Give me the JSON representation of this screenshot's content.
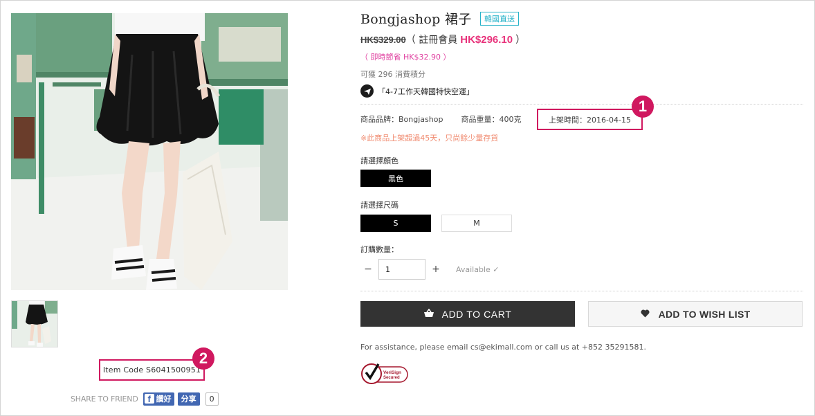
{
  "product": {
    "title": "Bongjashop 裙子",
    "tag": "韓國直送",
    "old_price": "HK$329.00",
    "price_prefix": "（ 註冊會員",
    "member_price": "HK$296.10",
    "price_suffix": "）",
    "save_text": "（ 即時節省 HK$32.90 ）",
    "points_text": "可獲 296 消費積分",
    "shipping_text": "「4-7工作天韓國特快空運」",
    "brand_text": "商品品牌：Bongjashop",
    "weight_text": "商品重量：400克",
    "date_text": "上架時間：2016-04-15",
    "stock_warning": "※此商品上架超過45天，只尚餘少量存貨"
  },
  "badges": {
    "first": "1",
    "second": "2"
  },
  "color": {
    "label": "請選擇顏色",
    "options": [
      {
        "label": "黑色",
        "selected": true
      }
    ]
  },
  "size": {
    "label": "請選擇尺碼",
    "options": [
      {
        "label": "S",
        "selected": true
      },
      {
        "label": "M",
        "selected": false
      }
    ]
  },
  "quantity": {
    "label": "訂購數量：",
    "minus": "−",
    "value": "1",
    "plus": "+",
    "availability": "Available ✓"
  },
  "actions": {
    "add_to_cart": "ADD TO CART",
    "add_to_wishlist": "ADD TO WISH LIST"
  },
  "assistance_text": "For assistance, please email cs@ekimall.com or call us at +852 35291581.",
  "verisign": {
    "line1": "VeriSign",
    "line2": "Secured"
  },
  "item_code": "Item Code S6041500951",
  "share": {
    "label": "SHARE TO FRIEND",
    "like": "讚好",
    "share": "分享",
    "count": "0"
  },
  "colors": {
    "accent_pink": "#e8317a",
    "highlight_box": "#d0185f",
    "tag_teal": "#27b3c9",
    "facebook": "#4267b2",
    "cart_button": "#333333"
  }
}
